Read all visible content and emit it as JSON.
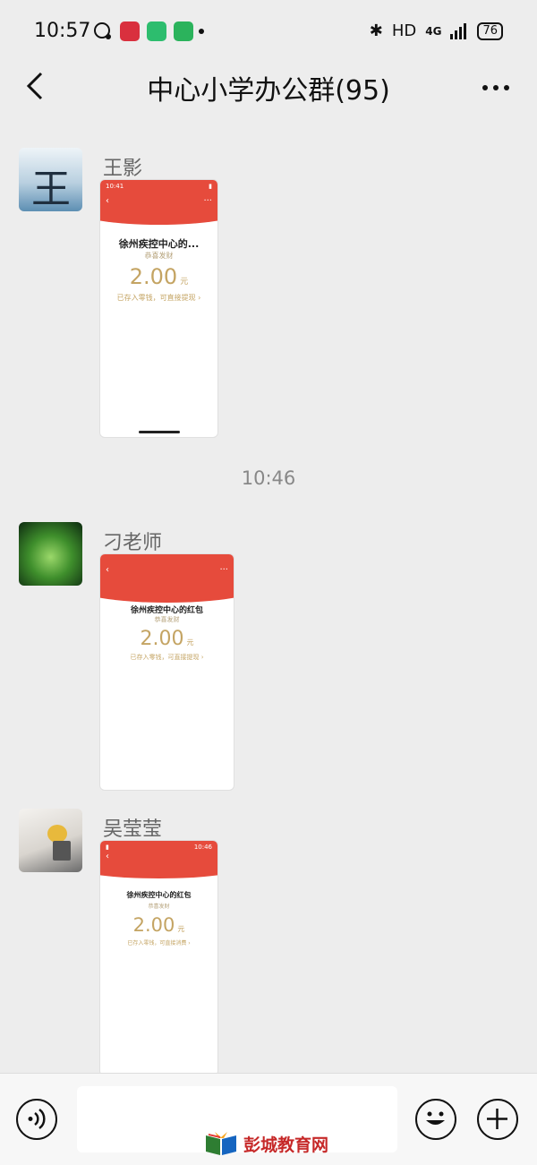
{
  "status_bar": {
    "time": "10:57",
    "hd": "HD",
    "network": "4G",
    "battery": "76"
  },
  "header": {
    "title": "中心小学办公群(95)",
    "back_icon": "chevron-left-icon",
    "more_icon": "more-horizontal-icon"
  },
  "messages": [
    {
      "sender": "王影",
      "card": {
        "status_time": "10:41",
        "payer": "徐州疾控中心的...",
        "greeting": "恭喜发财",
        "amount": "2.00",
        "unit": "元",
        "note": "已存入零钱，可直接提现 ›"
      }
    },
    {
      "sender": "刁老师",
      "card": {
        "payer": "徐州疾控中心的红包",
        "greeting": "恭喜发财",
        "amount": "2.00",
        "unit": "元",
        "note": "已存入零钱，可直接提现 ›"
      }
    },
    {
      "sender": "吴莹莹",
      "card": {
        "status_time": "10:46",
        "payer": "徐州疾控中心的红包",
        "greeting": "恭喜发财",
        "amount": "2.00",
        "unit": "元",
        "note": "已存入零钱，可直接消费 ›"
      }
    }
  ],
  "timestamp": "10:46",
  "bottom_bar": {
    "voice_icon": "voice-icon",
    "emoji_icon": "emoji-icon",
    "plus_icon": "plus-icon"
  },
  "watermark": {
    "text": "彭城教育网"
  },
  "colors": {
    "red": "#e64b3c",
    "gold": "#c4a463",
    "background": "#ededed"
  }
}
